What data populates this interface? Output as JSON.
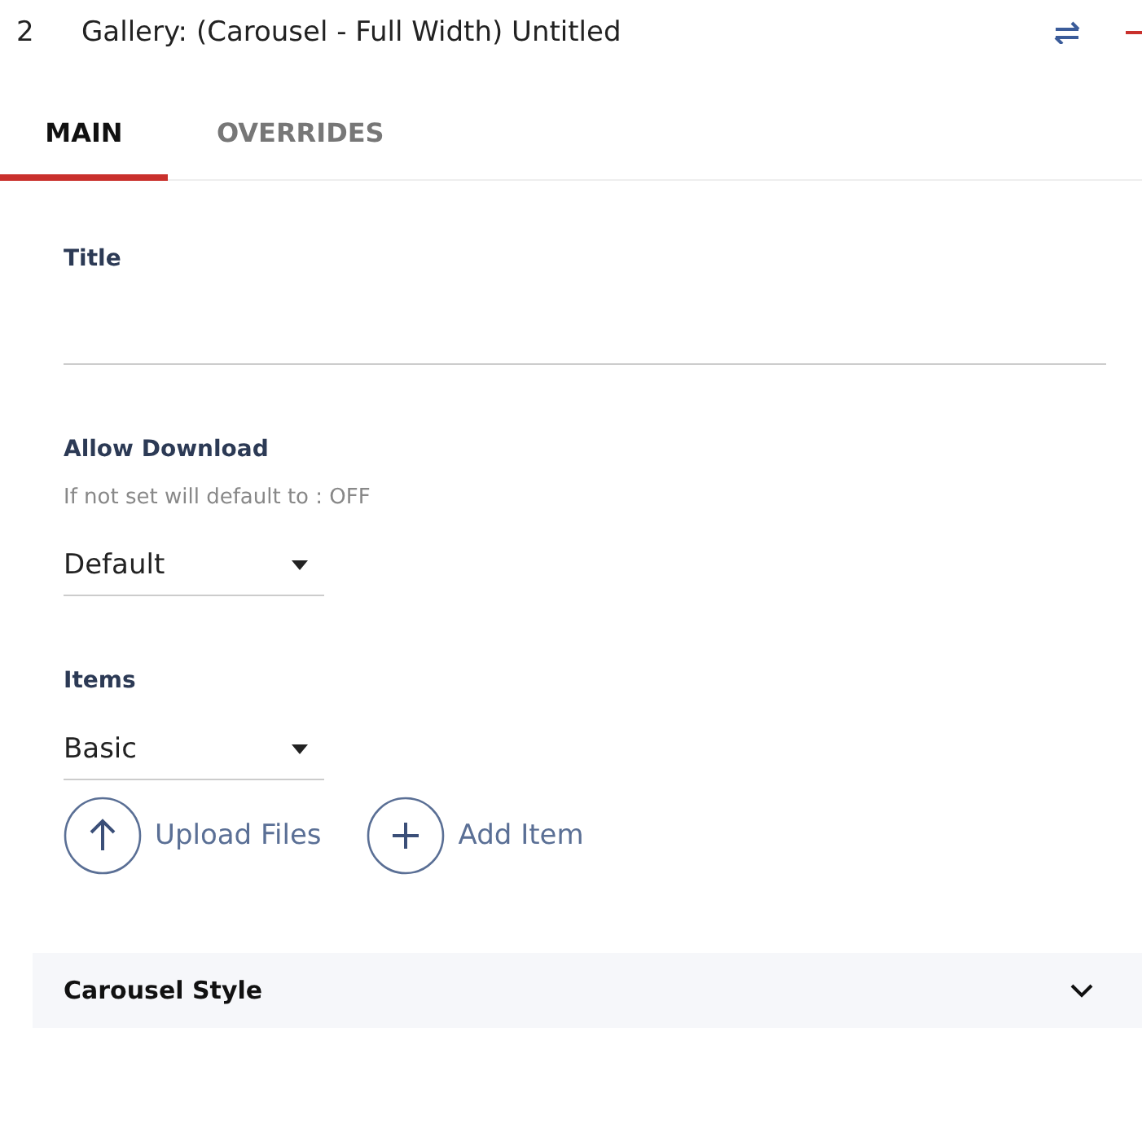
{
  "header": {
    "index": "2",
    "title": "Gallery: (Carousel - Full Width) Untitled"
  },
  "tabs": [
    {
      "label": "MAIN",
      "selected": true
    },
    {
      "label": "OVERRIDES",
      "selected": false
    }
  ],
  "fields": [
    {
      "kind": "text",
      "label": "Title"
    },
    {
      "kind": "select",
      "label": "Allow Download",
      "hint": "If not set will default to : OFF",
      "value": "Default"
    },
    {
      "kind": "select",
      "label": "Items",
      "value": "Basic"
    }
  ],
  "actions": [
    {
      "kind": "upload",
      "label": "Upload Files"
    },
    {
      "kind": "add",
      "label": "Add Item"
    }
  ],
  "section": {
    "title": "Carousel Style",
    "expanded": false
  }
}
